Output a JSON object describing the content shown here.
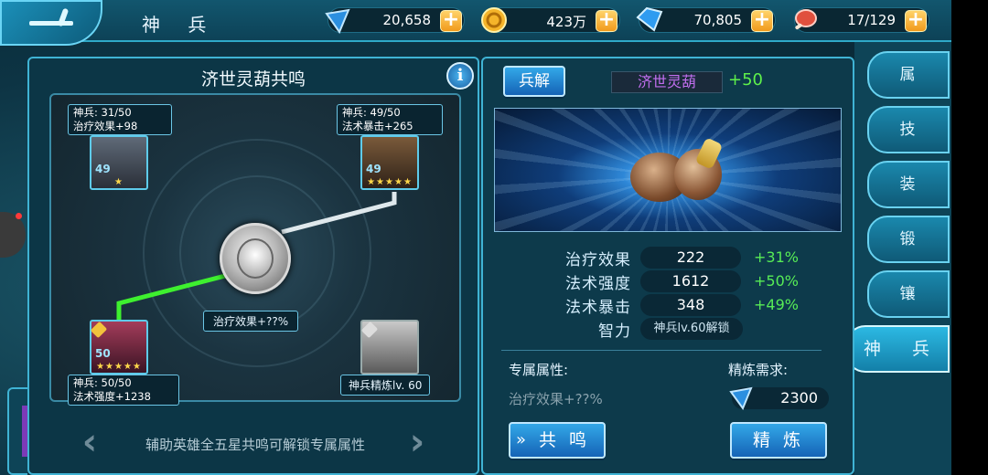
{
  "header": {
    "title": "神 兵",
    "resources": [
      {
        "icon": "blue-crystal-icon",
        "value": "20,658"
      },
      {
        "icon": "gold-coin-icon",
        "value": "423万"
      },
      {
        "icon": "diamond-gem-icon",
        "value": "70,805"
      },
      {
        "icon": "meat-stamina-icon",
        "value": "17/129"
      }
    ]
  },
  "tabs": [
    {
      "label": "属 性",
      "active": false
    },
    {
      "label": "技 能",
      "active": false
    },
    {
      "label": "装 备",
      "active": false
    },
    {
      "label": "锻 造",
      "active": false
    },
    {
      "label": "镶 嵌",
      "active": false
    },
    {
      "label": "神 兵",
      "active": true
    }
  ],
  "resonance": {
    "title": "济世灵葫共鸣",
    "nodes": [
      {
        "title": "神兵: 31/50",
        "bonus": "治疗效果+98",
        "level": "49",
        "stars": "★"
      },
      {
        "title": "神兵: 49/50",
        "bonus": "法术暴击+265",
        "level": "49",
        "stars": "★★★★★"
      },
      {
        "title": "神兵: 50/50",
        "bonus": "法术强度+1238",
        "level": "50",
        "stars": "★★★★★"
      }
    ],
    "center_label": "治疗效果+??%",
    "refine_label": "神兵精炼lv. 60",
    "hint": "辅助英雄全五星共鸣可解锁专属属性"
  },
  "weapon": {
    "disassemble_label": "兵解",
    "name": "济世灵葫",
    "plus": "+50",
    "stats": [
      {
        "label": "治疗效果",
        "value": "222",
        "bonus": "+31%"
      },
      {
        "label": "法术强度",
        "value": "1612",
        "bonus": "+50%"
      },
      {
        "label": "法术暴击",
        "value": "348",
        "bonus": "+49%"
      },
      {
        "label": "智力",
        "value": "神兵lv.60解锁",
        "bonus": ""
      }
    ],
    "exclusive_label": "专属属性:",
    "exclusive_value": "治疗效果+??%",
    "refine_req_label": "精炼需求:",
    "refine_cost": "2300",
    "resonate_label": "共 鸣",
    "refine_label": "精 炼"
  },
  "colors": {
    "bonus_green": "#57ec56",
    "weapon_name": "#c26ff0",
    "accent": "#3fb3d4"
  }
}
